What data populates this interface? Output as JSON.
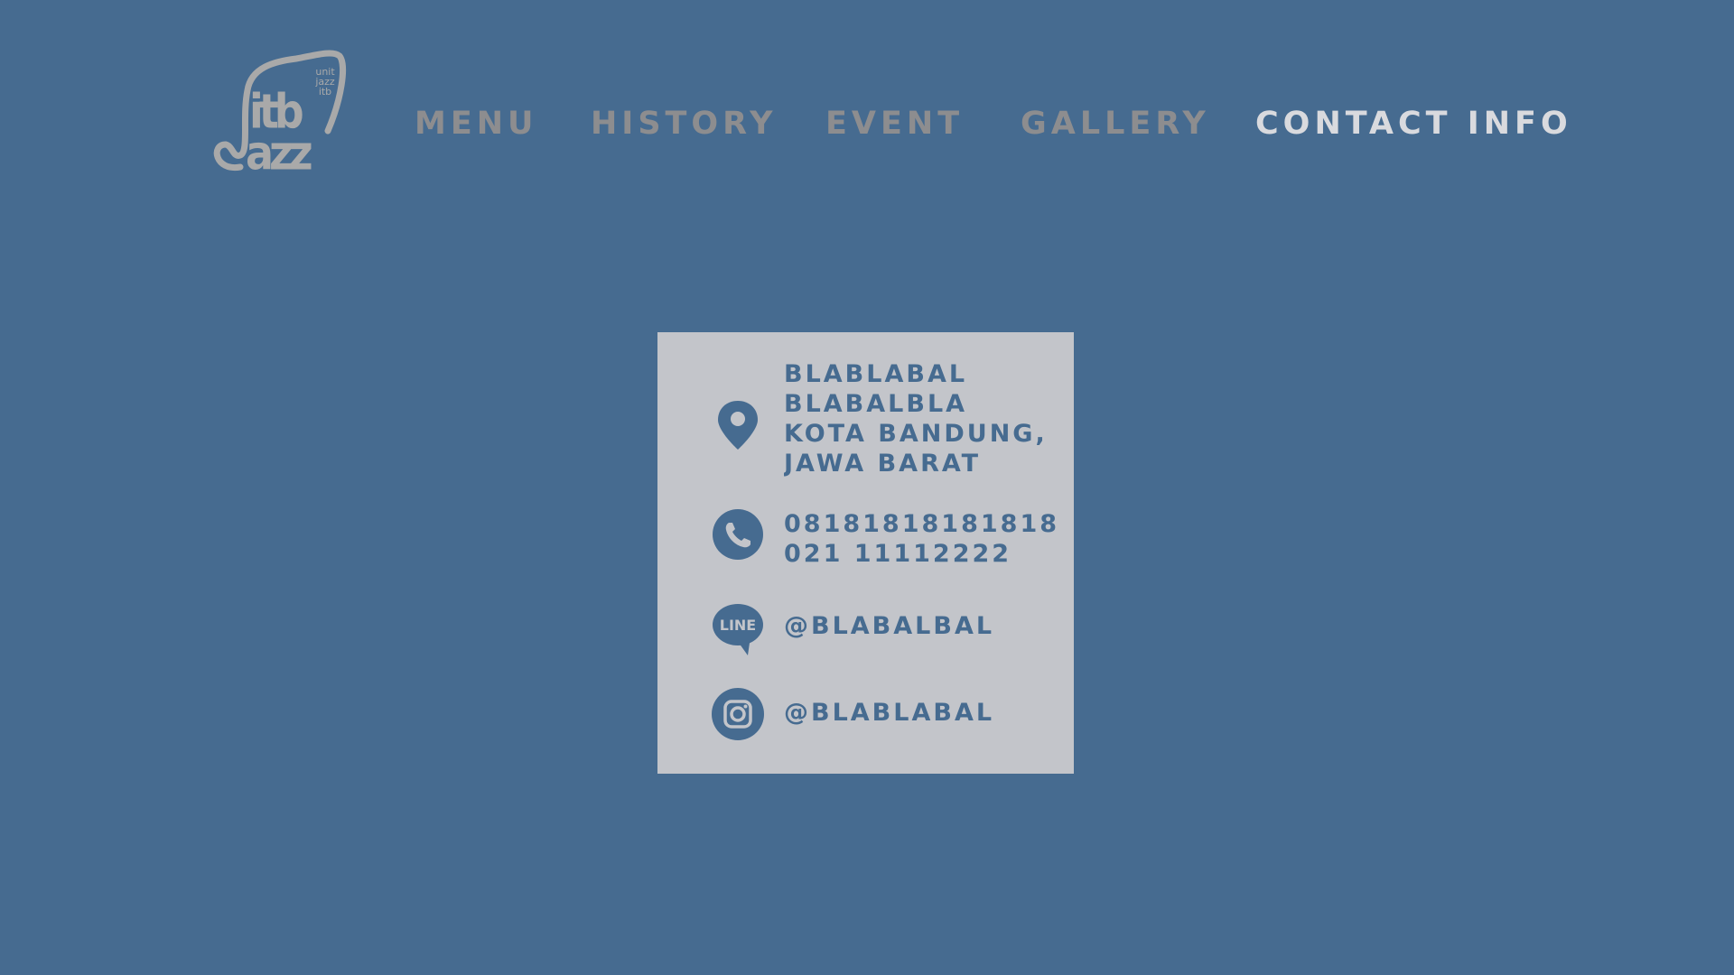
{
  "brand": {
    "logo_small_lines": [
      "unit",
      "jazz",
      "itb"
    ],
    "logo_word_top": "itb",
    "logo_word_bottom": "azz",
    "logo_color": "#a9a9a9"
  },
  "nav": {
    "items": [
      {
        "label": "MENU",
        "active": false
      },
      {
        "label": "HISTORY",
        "active": false
      },
      {
        "label": "EVENT",
        "active": false
      },
      {
        "label": "GALLERY",
        "active": false
      },
      {
        "label": "CONTACT INFO",
        "active": true
      }
    ],
    "inactive_color": "#8d8d8f",
    "active_color": "#d9dade"
  },
  "contact": {
    "address": {
      "icon": "location-pin-icon",
      "lines": [
        "BLABLABAL",
        "BLABALBLA",
        "KOTA BANDUNG,",
        "JAWA BARAT"
      ]
    },
    "phone": {
      "icon": "phone-icon",
      "lines": [
        "08181818181818",
        "021 11112222"
      ]
    },
    "line": {
      "icon": "line-app-icon",
      "icon_label": "LINE",
      "handle": "@BLABALBAL"
    },
    "instagram": {
      "icon": "instagram-icon",
      "handle": "@BLABLABAL"
    }
  },
  "colors": {
    "background": "#466b90",
    "card": "#c3c5ca",
    "accent": "#466b90"
  }
}
